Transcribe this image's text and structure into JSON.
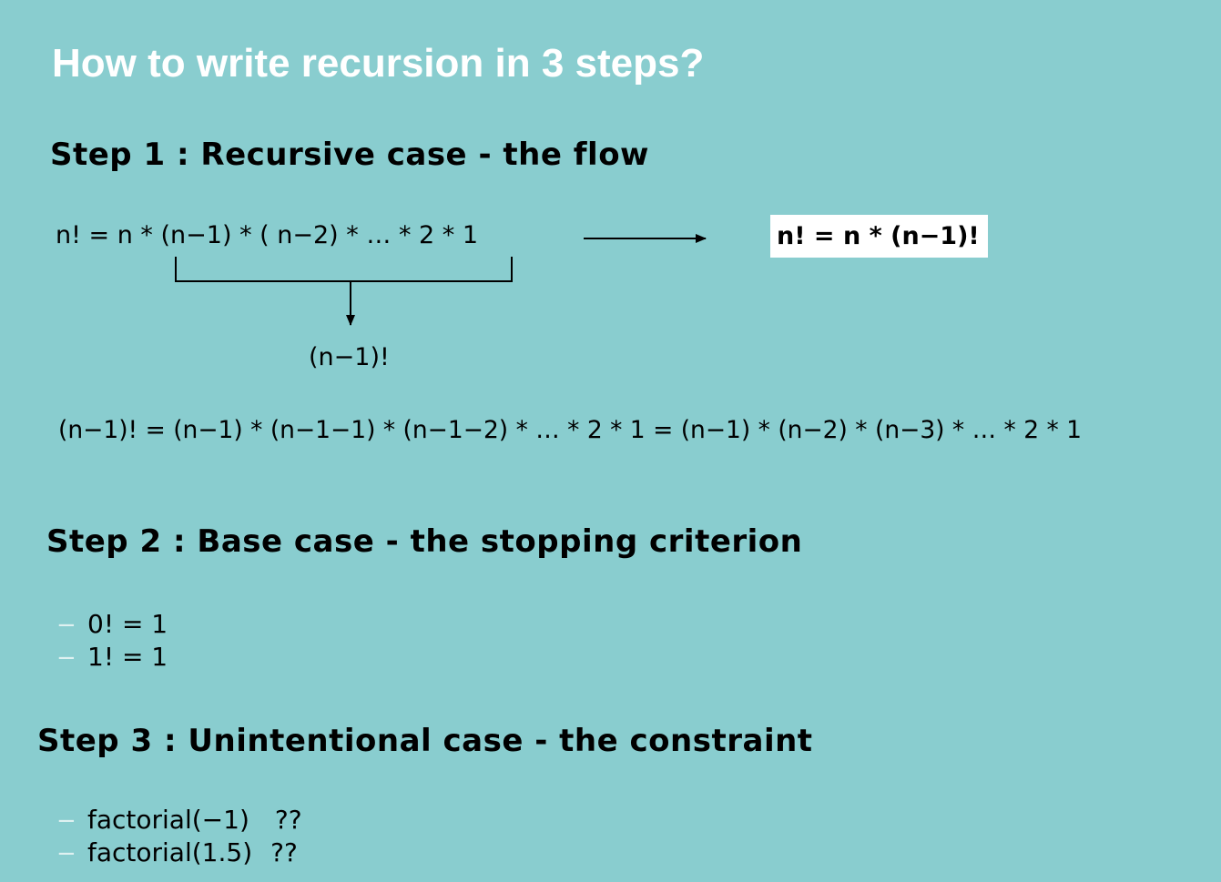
{
  "title": "How to write recursion in 3 steps?",
  "step1": {
    "heading": "Step 1 : Recursive case - the flow",
    "expansion": "n! = n * (n−1) * ( n−2) * … * 2 * 1",
    "brace_result": "(n−1)!",
    "result": "n! = n * (n−1)!",
    "sub_expansion": "(n−1)! = (n−1) * (n−1−1) * (n−1−2) * … * 2 * 1 = (n−1) * (n−2) * (n−3) * … * 2 * 1"
  },
  "step2": {
    "heading": "Step 2 : Base case - the stopping criterion",
    "items": [
      {
        "dash": "−",
        "text": "0! = 1"
      },
      {
        "dash": "−",
        "text": "1! = 1"
      }
    ]
  },
  "step3": {
    "heading": "Step 3 : Unintentional case - the constraint",
    "items": [
      {
        "dash": "−",
        "text": "factorial(−1)",
        "note": "??"
      },
      {
        "dash": "−",
        "text": "factorial(1.5)",
        "note": "??"
      }
    ]
  },
  "colors": {
    "background": "#89cdcf",
    "title": "#ffffff",
    "box": "#ffffff",
    "dash": "#dff1f1"
  }
}
